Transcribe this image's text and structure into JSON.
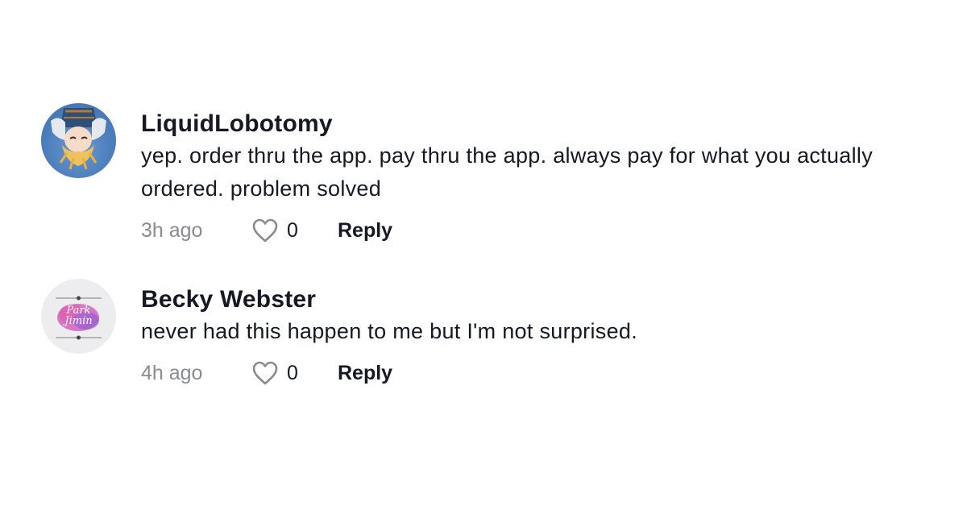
{
  "comments": [
    {
      "username": "LiquidLobotomy",
      "text": "yep. order thru the app. pay thru the app. always pay for what you actually ordered. problem solved",
      "time": "3h ago",
      "likes": "0",
      "reply_label": "Reply",
      "avatar": "anime-character-upside-down"
    },
    {
      "username": "Becky Webster",
      "text": "never had this happen to me but I'm not surprised.",
      "time": "4h ago",
      "likes": "0",
      "reply_label": "Reply",
      "avatar": "park-jimin-watercolor",
      "avatar_text": [
        "Park",
        "Jimin"
      ]
    }
  ],
  "colors": {
    "primary_text": "#161823",
    "secondary_text": "#8a8b91",
    "icon": "#8a8b91"
  }
}
